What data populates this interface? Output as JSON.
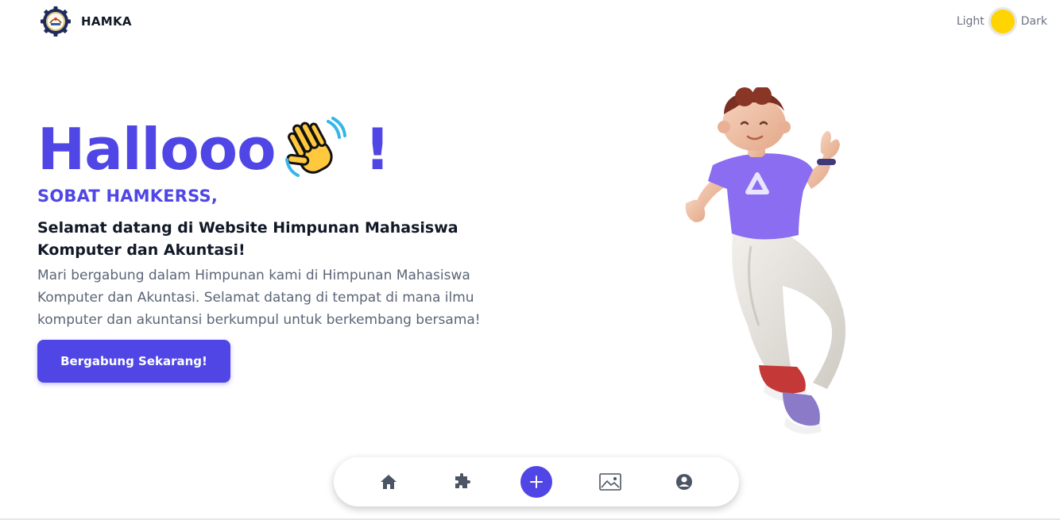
{
  "header": {
    "brand": "HAMKA",
    "logo_icon": "gear-seal-logo",
    "theme": {
      "light_label": "Light",
      "dark_label": "Dark",
      "toggle_icon": "sun-icon",
      "toggle_color": "#ffd400"
    }
  },
  "hero": {
    "hello": "Hallooo",
    "exclaim": "!",
    "wave_icon": "waving-hand-icon",
    "greeting": "SOBAT HAMKERSS,",
    "welcome": "Selamat datang di Website Himpunan Mahasiswa Komputer dan Akuntasi!",
    "description": "Mari bergabung dalam Himpunan kami di Himpunan Mahasiswa Komputer dan Akuntasi. Selamat datang di tempat di mana ilmu komputer dan akuntansi berkumpul untuk berkembang bersama!",
    "cta_label": "Bergabung Sekarang!"
  },
  "nav": {
    "items": [
      {
        "icon": "home-icon"
      },
      {
        "icon": "puzzle-icon"
      },
      {
        "icon": "add-icon"
      },
      {
        "icon": "image-icon"
      },
      {
        "icon": "user-icon"
      }
    ]
  },
  "colors": {
    "accent": "#4f46e5",
    "text_muted": "#5b6577"
  }
}
